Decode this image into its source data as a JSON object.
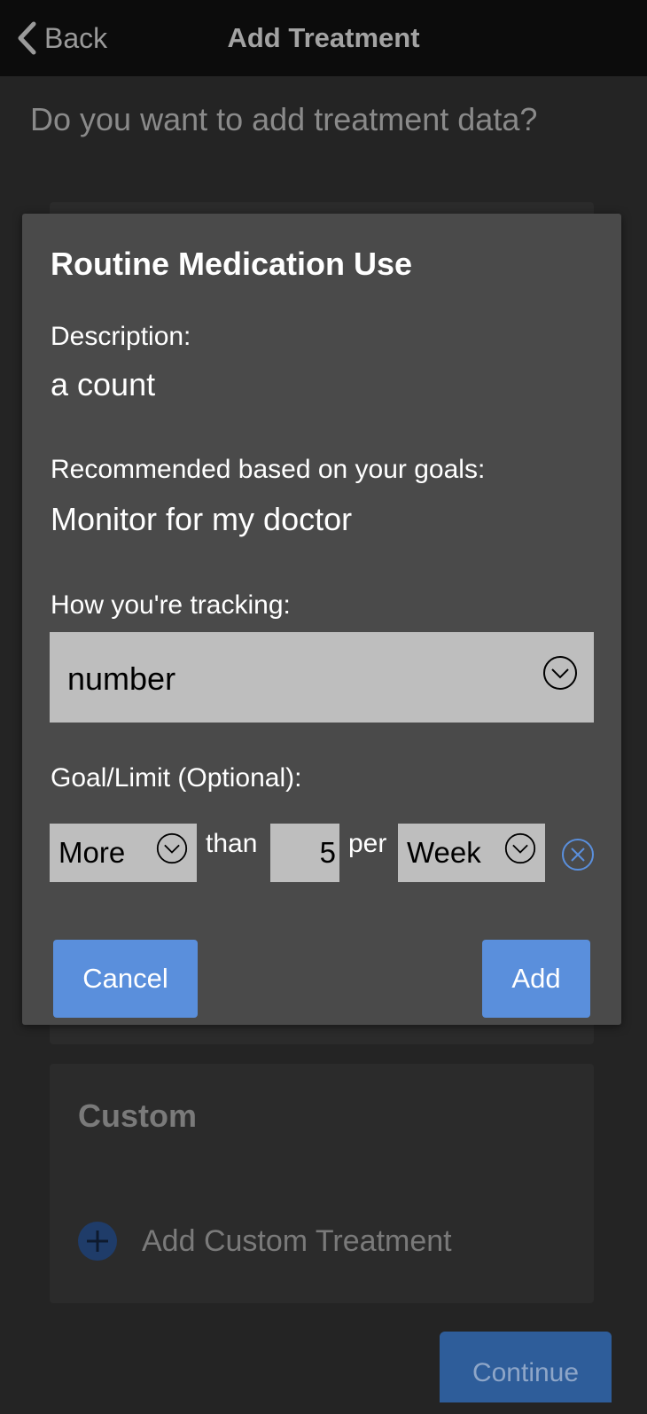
{
  "nav": {
    "back_label": "Back",
    "title": "Add Treatment"
  },
  "page": {
    "question": "Do you want to add treatment data?"
  },
  "custom_section": {
    "title": "Custom",
    "add_label": "Add Custom Treatment"
  },
  "footer": {
    "continue_label": "Continue"
  },
  "modal": {
    "title": "Routine Medication Use",
    "description_label": "Description:",
    "description_value": "a count",
    "recommended_label": "Recommended based on your goals:",
    "recommended_value": "Monitor for my doctor",
    "tracking_label": "How you're tracking:",
    "tracking_value": "number",
    "goal_label": "Goal/Limit (Optional):",
    "goal": {
      "comparison": "More",
      "than_word": "than",
      "amount": "5",
      "per_word": "per",
      "period": "Week"
    },
    "cancel_label": "Cancel",
    "add_label": "Add"
  },
  "colors": {
    "accent": "#5a8fdc",
    "modal_bg": "#4a4a4a",
    "page_bg": "#242424",
    "select_bg": "#bebebe"
  }
}
